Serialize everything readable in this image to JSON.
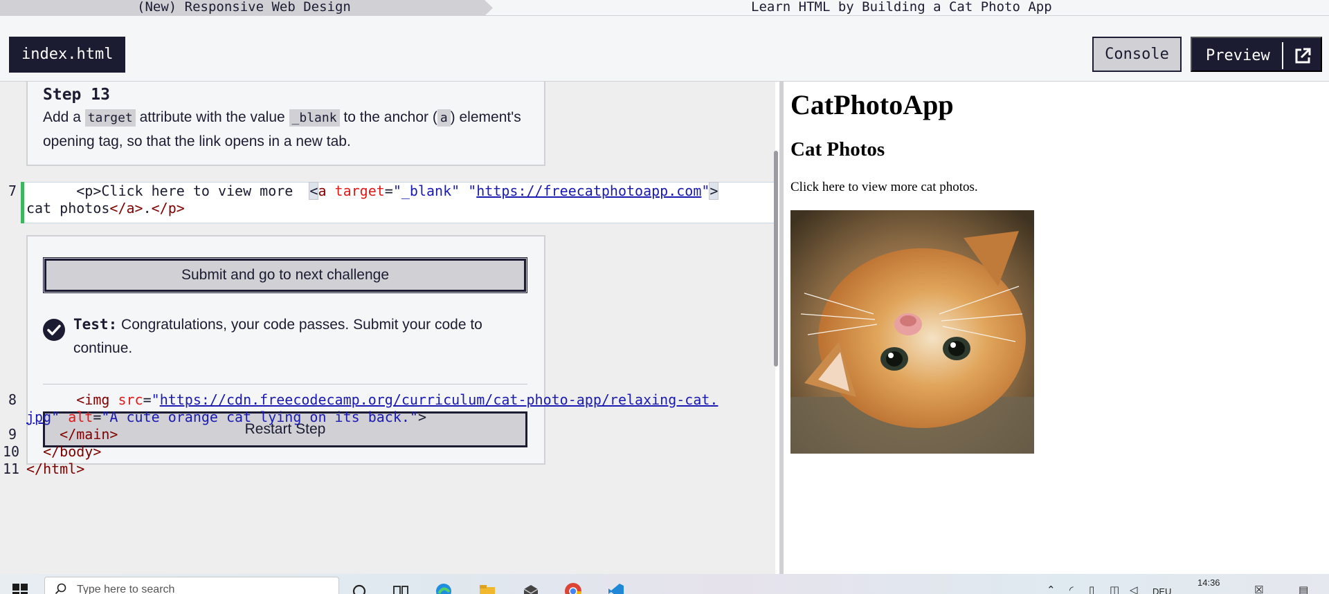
{
  "breadcrumb": {
    "superblock": "(New) Responsive Web Design",
    "block": "Learn HTML by Building a Cat Photo App"
  },
  "toolbar": {
    "file_tab": "index.html",
    "console_label": "Console",
    "preview_label": "Preview"
  },
  "step": {
    "title": "Step 13",
    "desc_1": "Add a ",
    "code_1": "target",
    "desc_2": " attribute with the value ",
    "code_2": "_blank",
    "desc_3": " to the anchor (",
    "code_3": "a",
    "desc_4": ") element's opening tag, so that the link opens in a new tab."
  },
  "code": {
    "line7_num": "7",
    "line7_indent": "      ",
    "line7_p_open": "<p>",
    "line7_text": "Click here to view more  ",
    "line7_a_open": "<",
    "line7_a_name": "a",
    "line7_attr1": " target",
    "line7_eq1": "=",
    "line7_val1": "\"_blank\"",
    "line7_space": " ",
    "line7_q_open": "\"",
    "line7_url": "https://freecatphotoapp.com",
    "line7_q_close": "\"",
    "line7_gt": ">",
    "line7b_text": "cat photos",
    "line7b_a_close": "</a>",
    "line7b_dot": ".",
    "line7b_p_close": "</p>",
    "line8_num": "8",
    "line8_indent": "      ",
    "line8_tag": "<img",
    "line8_attr1": " src",
    "line8_eq": "=",
    "line8_q": "\"",
    "line8_url_a": "https://cdn.freecodecamp.org/curriculum/cat-photo-app/relaxing-cat.",
    "line8_url_b": "jpg",
    "line8_q2": "\"",
    "line8_attr2": " alt",
    "line8_val2": "\"A cute orange cat lying on its back.\"",
    "line8_close": ">",
    "line9_num": "9",
    "line9_code": "    </main>",
    "line10_num": "10",
    "line10_code": "  </body>",
    "line11_num": "11",
    "line11_code": "</html>"
  },
  "test": {
    "submit_label": "Submit and go to next challenge",
    "label": "Test:",
    "message": " Congratulations, your code passes. Submit your code to continue.",
    "restart_label": "Restart Step"
  },
  "preview": {
    "h1": "CatPhotoApp",
    "h2": "Cat Photos",
    "paragraph": "Click here to view more cat photos.",
    "image_alt": "A cute orange cat lying on its back."
  },
  "taskbar": {
    "search_placeholder": "Type here to search",
    "language": "DEU",
    "time": "14:36"
  },
  "colors": {
    "navy": "#1b1b32",
    "light_gray": "#d0d0d5",
    "pass_green": "#3eb55e"
  }
}
